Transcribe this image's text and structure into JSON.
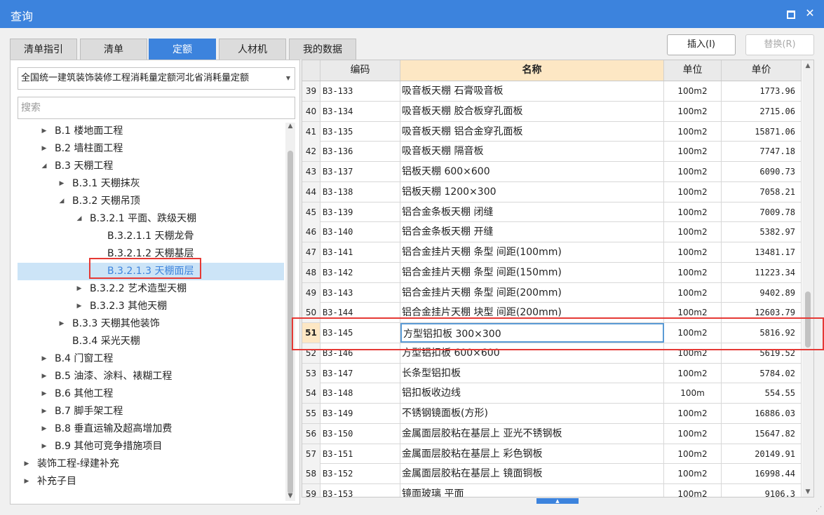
{
  "window": {
    "title": "查询",
    "maximize_icon": "maximize-icon",
    "close_label": "✕"
  },
  "tabs": [
    {
      "label": "清单指引",
      "active": false
    },
    {
      "label": "清单",
      "active": false
    },
    {
      "label": "定额",
      "active": true
    },
    {
      "label": "人材机",
      "active": false
    },
    {
      "label": "我的数据",
      "active": false
    }
  ],
  "actions": {
    "insert_label": "插入(I)",
    "replace_label": "替换(R)",
    "replace_disabled": true
  },
  "library_select": {
    "value": "全国统一建筑装饰装修工程消耗量定额河北省消耗量定额"
  },
  "search": {
    "placeholder": "搜索",
    "value": ""
  },
  "tree": [
    {
      "label": "B.1 楼地面工程",
      "level": 1,
      "arrow": "collapsed"
    },
    {
      "label": "B.2 墙柱面工程",
      "level": 1,
      "arrow": "collapsed"
    },
    {
      "label": "B.3 天棚工程",
      "level": 1,
      "arrow": "expanded"
    },
    {
      "label": "B.3.1 天棚抹灰",
      "level": 2,
      "arrow": "collapsed"
    },
    {
      "label": "B.3.2 天棚吊顶",
      "level": 2,
      "arrow": "expanded"
    },
    {
      "label": "B.3.2.1 平面、跌级天棚",
      "level": 3,
      "arrow": "expanded"
    },
    {
      "label": "B.3.2.1.1 天棚龙骨",
      "level": 4,
      "arrow": "none"
    },
    {
      "label": "B.3.2.1.2 天棚基层",
      "level": 4,
      "arrow": "none"
    },
    {
      "label": "B.3.2.1.3 天棚面层",
      "level": 4,
      "arrow": "none",
      "selected": true
    },
    {
      "label": "B.3.2.2 艺术造型天棚",
      "level": 3,
      "arrow": "collapsed"
    },
    {
      "label": "B.3.2.3 其他天棚",
      "level": 3,
      "arrow": "collapsed"
    },
    {
      "label": "B.3.3 天棚其他装饰",
      "level": 2,
      "arrow": "collapsed"
    },
    {
      "label": "B.3.4 采光天棚",
      "level": 2,
      "arrow": "none"
    },
    {
      "label": "B.4 门窗工程",
      "level": 1,
      "arrow": "collapsed"
    },
    {
      "label": "B.5 油漆、涂料、裱糊工程",
      "level": 1,
      "arrow": "collapsed"
    },
    {
      "label": "B.6 其他工程",
      "level": 1,
      "arrow": "collapsed"
    },
    {
      "label": "B.7 脚手架工程",
      "level": 1,
      "arrow": "collapsed"
    },
    {
      "label": "B.8 垂直运输及超高增加费",
      "level": 1,
      "arrow": "collapsed"
    },
    {
      "label": "B.9 其他可竞争措施项目",
      "level": 1,
      "arrow": "collapsed"
    },
    {
      "label": "装饰工程-绿建补充",
      "level": 0,
      "arrow": "collapsed"
    },
    {
      "label": "补充子目",
      "level": 0,
      "arrow": "collapsed"
    }
  ],
  "grid": {
    "headers": {
      "code": "编码",
      "name": "名称",
      "unit": "单位",
      "price": "单价"
    },
    "current_row": "51",
    "rows": [
      {
        "idx": "39",
        "code": "B3-133",
        "name": "吸音板天棚 石膏吸音板",
        "unit": "100m2",
        "price": "1773.96"
      },
      {
        "idx": "40",
        "code": "B3-134",
        "name": "吸音板天棚 胶合板穿孔面板",
        "unit": "100m2",
        "price": "2715.06"
      },
      {
        "idx": "41",
        "code": "B3-135",
        "name": "吸音板天棚 铝合金穿孔面板",
        "unit": "100m2",
        "price": "15871.06"
      },
      {
        "idx": "42",
        "code": "B3-136",
        "name": "吸音板天棚 隔音板",
        "unit": "100m2",
        "price": "7747.18"
      },
      {
        "idx": "43",
        "code": "B3-137",
        "name": "铝板天棚 600×600",
        "unit": "100m2",
        "price": "6090.73"
      },
      {
        "idx": "44",
        "code": "B3-138",
        "name": "铝板天棚 1200×300",
        "unit": "100m2",
        "price": "7058.21"
      },
      {
        "idx": "45",
        "code": "B3-139",
        "name": "铝合金条板天棚 闭缝",
        "unit": "100m2",
        "price": "7009.78"
      },
      {
        "idx": "46",
        "code": "B3-140",
        "name": "铝合金条板天棚 开缝",
        "unit": "100m2",
        "price": "5382.97"
      },
      {
        "idx": "47",
        "code": "B3-141",
        "name": "铝合金挂片天棚 条型 间距(100mm)",
        "unit": "100m2",
        "price": "13481.17"
      },
      {
        "idx": "48",
        "code": "B3-142",
        "name": "铝合金挂片天棚 条型 间距(150mm)",
        "unit": "100m2",
        "price": "11223.34"
      },
      {
        "idx": "49",
        "code": "B3-143",
        "name": "铝合金挂片天棚 条型 间距(200mm)",
        "unit": "100m2",
        "price": "9402.89"
      },
      {
        "idx": "50",
        "code": "B3-144",
        "name": "铝合金挂片天棚 块型 间距(200mm)",
        "unit": "100m2",
        "price": "12603.79"
      },
      {
        "idx": "51",
        "code": "B3-145",
        "name": "方型铝扣板 300×300",
        "unit": "100m2",
        "price": "5816.92"
      },
      {
        "idx": "52",
        "code": "B3-146",
        "name": "方型铝扣板 600×600",
        "unit": "100m2",
        "price": "5619.52"
      },
      {
        "idx": "53",
        "code": "B3-147",
        "name": "长条型铝扣板",
        "unit": "100m2",
        "price": "5784.02"
      },
      {
        "idx": "54",
        "code": "B3-148",
        "name": "铝扣板收边线",
        "unit": "100m",
        "price": "554.55"
      },
      {
        "idx": "55",
        "code": "B3-149",
        "name": "不锈钢镜面板(方形)",
        "unit": "100m2",
        "price": "16886.03"
      },
      {
        "idx": "56",
        "code": "B3-150",
        "name": "金属面层胶粘在基层上 亚光不锈钢板",
        "unit": "100m2",
        "price": "15647.82"
      },
      {
        "idx": "57",
        "code": "B3-151",
        "name": "金属面层胶粘在基层上 彩色钢板",
        "unit": "100m2",
        "price": "20149.91"
      },
      {
        "idx": "58",
        "code": "B3-152",
        "name": "金属面层胶粘在基层上 镜面铜板",
        "unit": "100m2",
        "price": "16998.44"
      },
      {
        "idx": "59",
        "code": "B3-153",
        "name": "镜面玻璃 平面",
        "unit": "100m2",
        "price": "9106.3"
      }
    ]
  },
  "colors": {
    "accent": "#3c83dd",
    "highlight_border": "#e53935",
    "current_header": "#fde7c4"
  }
}
